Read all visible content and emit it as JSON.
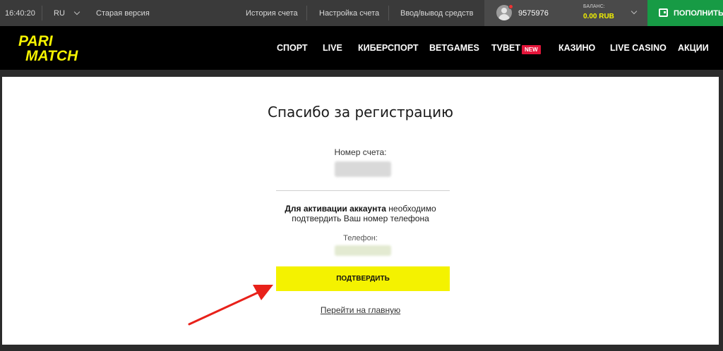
{
  "topbar": {
    "time": "16:40:20",
    "language": "RU",
    "old_version": "Старая версия",
    "links": [
      "История счета",
      "Настройка счета",
      "Ввод/вывод средств"
    ],
    "user_id": "9575976",
    "balance_label": "БАЛАНС:",
    "balance_value": "0.00 RUB",
    "topup_label": "ПОПОЛНИТЬ"
  },
  "logo": {
    "line1": "PARI",
    "line2": "MATCH"
  },
  "nav": {
    "items": [
      "СПОРТ",
      "LIVE",
      "КИБЕРСПОРТ",
      "BETGAMES",
      "TVBET",
      "КАЗИНО",
      "LIVE CASINO",
      "АКЦИИ"
    ],
    "new_badge": "NEW"
  },
  "card": {
    "title": "Спасибо за регистрацию",
    "account_label": "Номер счета:",
    "activation_bold": "Для активации аккаунта",
    "activation_rest": " необходимо",
    "activation_line2": "подтвердить Ваш номер телефона",
    "phone_label": "Телефон:",
    "confirm_label": "ПОДТВЕРДИТЬ",
    "home_link": "Перейти на главную"
  },
  "colors": {
    "brand_yellow": "#f4f200",
    "topup_green": "#179b45",
    "arrow_red": "#e8211a",
    "new_badge": "#e4153a"
  }
}
